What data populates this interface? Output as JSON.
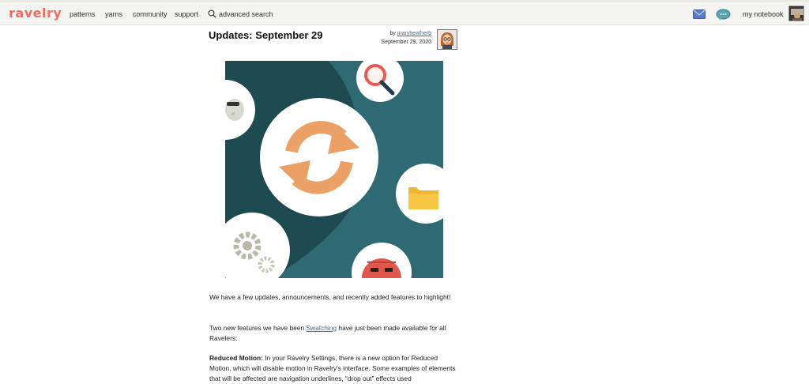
{
  "header": {
    "logo": "ravelry",
    "nav": [
      "patterns",
      "yarns",
      "community",
      "support"
    ],
    "search_label": "advanced search",
    "notebook_label": "my notebook"
  },
  "article": {
    "title": "Updates: September 29",
    "by_prefix": "by",
    "author": "maryheatherb",
    "date": "September 29, 2020",
    "para1": "We have a few updates, announcements, and recently added features to highlight!",
    "para2_before": "Two new features we have been ",
    "para2_link": "Swatching",
    "para2_after": " have just been made available for all Ravelers:",
    "para3_bold": "Reduced Motion:",
    "para3_text": " In your Ravelry Settings, there is a new option for Reduced Motion, which will disable motion in Ravelry's interface. Some examples of elements that will be affected are navigation underlines, “drop out” effects used"
  },
  "colors": {
    "logo": "#ee6e62",
    "hero_dark": "#1e4a52",
    "hero_teal": "#2f6a74",
    "sync_orange": "#eba066",
    "link": "#4a6b8c"
  },
  "icons": [
    "search-icon",
    "message-icon",
    "forum-icon",
    "user-avatar",
    "sync-icon",
    "magnifier-icon",
    "folder-icon",
    "gears-icon",
    "yarn-ball-icon",
    "sheep-icon"
  ]
}
